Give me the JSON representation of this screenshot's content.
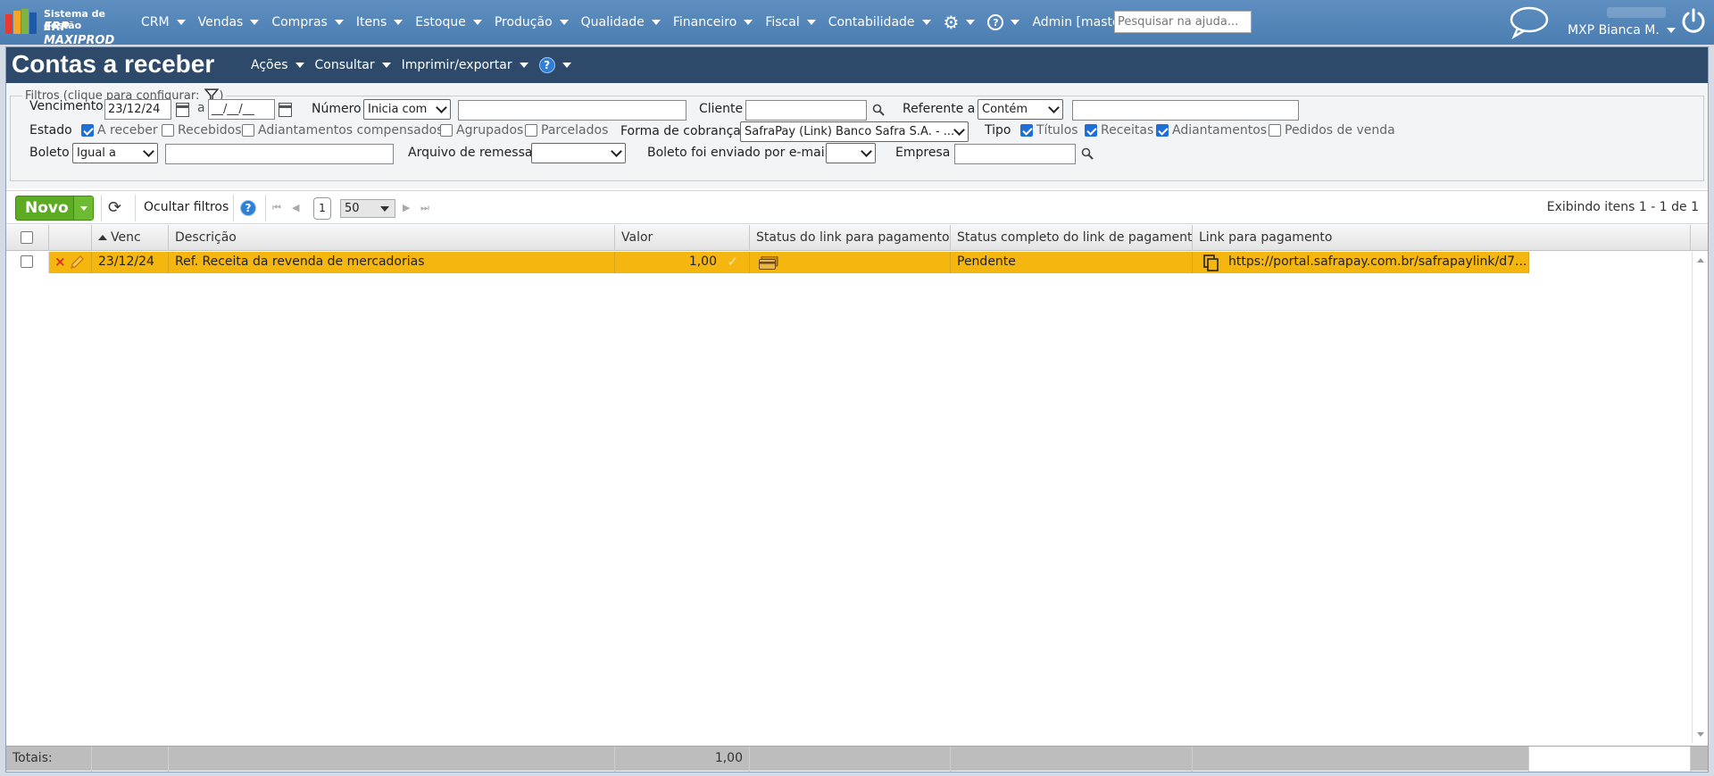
{
  "app": {
    "logo_line1": "Sistema de gestão",
    "logo_line2": "ERP MAXIPROD",
    "menu": [
      "CRM",
      "Vendas",
      "Compras",
      "Itens",
      "Estoque",
      "Produção",
      "Qualidade",
      "Financeiro",
      "Fiscal",
      "Contabilidade"
    ],
    "admin_label": "Admin [master]",
    "help_search_placeholder": "Pesquisar na ajuda...",
    "user_name": "MXP Bianca M.",
    "help_q": "?"
  },
  "page": {
    "title": "Contas a receber",
    "actions": [
      "Ações",
      "Consultar",
      "Imprimir/exportar"
    ],
    "help_glyph": "?"
  },
  "filters": {
    "legend": "Filtros (clique para configurar:",
    "legend_close": ")",
    "vencimento_label": "Vencimento",
    "venc_from": "23/12/24",
    "venc_sep": "a",
    "venc_to": "__/__/__",
    "numero_label": "Número",
    "numero_op": "Inicia com",
    "numero_value": "",
    "cliente_label": "Cliente",
    "cliente_value": "",
    "referente_label": "Referente a",
    "referente_op": "Contém",
    "referente_value": "",
    "estado_label": "Estado",
    "estado_options": [
      {
        "label": "A receber",
        "checked": true
      },
      {
        "label": "Recebidos",
        "checked": false
      },
      {
        "label": "Adiantamentos compensados",
        "checked": false
      },
      {
        "label": "Agrupados",
        "checked": false
      },
      {
        "label": "Parcelados",
        "checked": false
      }
    ],
    "forma_label": "Forma de cobrança",
    "forma_value": "SafraPay (Link) Banco Safra S.A. - ...",
    "tipo_label": "Tipo",
    "tipo_options": [
      {
        "label": "Títulos",
        "checked": true
      },
      {
        "label": "Receitas",
        "checked": true
      },
      {
        "label": "Adiantamentos",
        "checked": true
      },
      {
        "label": "Pedidos de venda",
        "checked": false
      }
    ],
    "boleto_label": "Boleto",
    "boleto_op": "Igual a",
    "boleto_value": "",
    "arquivo_label": "Arquivo de remessa",
    "arquivo_value": "",
    "boleto_email_label": "Boleto foi enviado por e-mail",
    "boleto_email_value": "",
    "empresa_label": "Empresa",
    "empresa_value": ""
  },
  "toolbar": {
    "novo_label": "Novo",
    "hide_filters_label": "Ocultar filtros",
    "help_glyph": "?",
    "page": "1",
    "per_page": "50",
    "showing": "Exibindo itens 1 - 1 de 1"
  },
  "grid": {
    "columns": {
      "venc": "Venc",
      "descricao": "Descrição",
      "valor": "Valor",
      "status_link": "Status do link para pagamento",
      "status_completo": "Status completo do link de pagamento",
      "link": "Link para pagamento"
    },
    "rows": [
      {
        "venc": "23/12/24",
        "descricao": "Ref. Receita da revenda de mercadorias",
        "valor": "1,00",
        "status_completo": "Pendente",
        "link": "https://portal.safrapay.com.br/safrapaylink/d7..."
      }
    ],
    "totals_label": "Totais:",
    "totals_valor": "1,00"
  },
  "colors": {
    "topbar": "#5087bd",
    "title_bar": "#2e4a6b",
    "row_highlight": "#f5b60f",
    "novo_green": "#5cab23",
    "checkbox_blue": "#1f6fd8"
  },
  "icons": [
    "chat-bubble-icon",
    "power-icon",
    "gear-icon",
    "help-icon",
    "filter-icon",
    "calendar-icon",
    "search-icon",
    "refresh-icon",
    "delete-icon",
    "edit-icon",
    "check-icon",
    "card-icon",
    "copy-icon"
  ]
}
